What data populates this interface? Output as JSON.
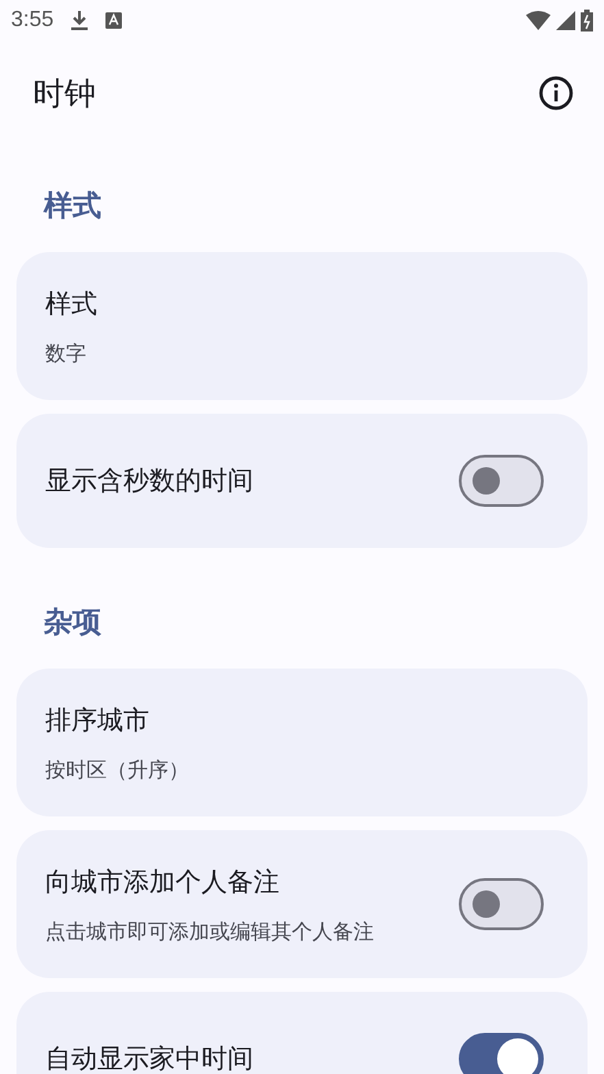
{
  "status_bar": {
    "time": "3:55"
  },
  "app_bar": {
    "title": "时钟"
  },
  "sections": [
    {
      "title": "样式",
      "items": [
        {
          "kind": "text",
          "title": "样式",
          "summary": "数字"
        },
        {
          "kind": "switch",
          "title": "显示含秒数的时间",
          "on": false
        }
      ]
    },
    {
      "title": "杂项",
      "items": [
        {
          "kind": "text",
          "title": "排序城市",
          "summary": "按时区（升序）"
        },
        {
          "kind": "switch",
          "title": "向城市添加个人备注",
          "summary": "点击城市即可添加或编辑其个人备注",
          "on": false
        },
        {
          "kind": "switch",
          "title": "自动显示家中时间",
          "on": true
        }
      ]
    }
  ]
}
